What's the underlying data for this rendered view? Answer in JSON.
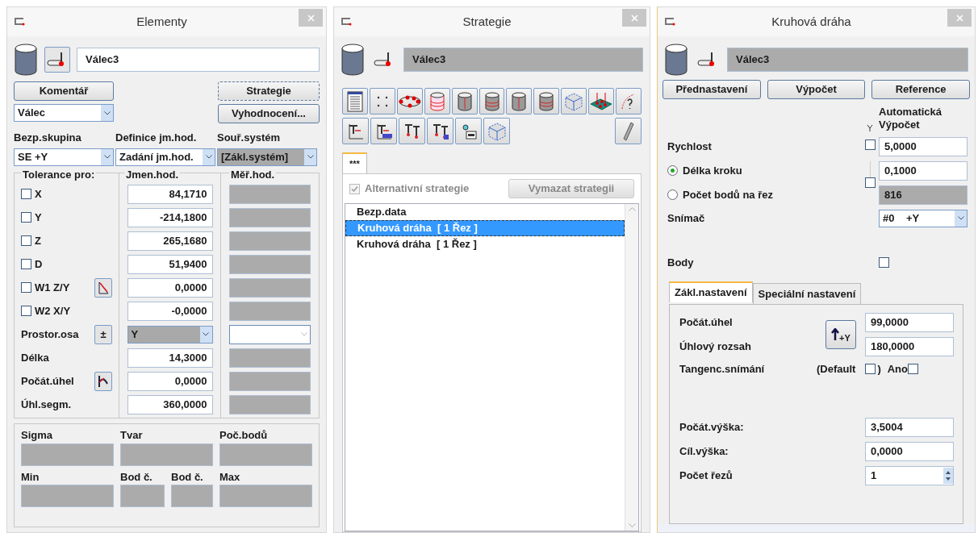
{
  "elementy": {
    "title": "Elementy",
    "name_value": "Válec3",
    "comment_button": "Komentář",
    "strategy_button": "Strategie",
    "eval_button": "Vyhodnocení...",
    "type_select": "Válec",
    "selects": [
      {
        "label": "Bezp.skupina",
        "value": "SE +Y",
        "disabled": false
      },
      {
        "label": "Definice jm.hod.",
        "value": "Zadání jm.hod.",
        "disabled": false
      },
      {
        "label": "Souř.systém",
        "value": "[Zákl.systém]",
        "disabled": true
      }
    ],
    "tolerance": {
      "headers": [
        "Tolerance pro:",
        "Jmen.hod.",
        "Měř.hod."
      ],
      "rows": [
        {
          "kind": "check",
          "label": "X",
          "checked": false,
          "nominal": "84,1710"
        },
        {
          "kind": "check",
          "label": "Y",
          "checked": false,
          "nominal": "-214,1800"
        },
        {
          "kind": "check",
          "label": "Z",
          "checked": false,
          "nominal": "265,1680"
        },
        {
          "kind": "check",
          "label": "D",
          "checked": false,
          "nominal": "51,9400"
        },
        {
          "kind": "check_tool",
          "label": "W1 Z/Y",
          "checked": false,
          "nominal": "0,0000"
        },
        {
          "kind": "check",
          "label": "W2 X/Y",
          "checked": false,
          "nominal": "-0,0000"
        },
        {
          "kind": "axis",
          "label": "Prostor.osa",
          "tool_label": "±",
          "nominal": "Y"
        },
        {
          "kind": "value",
          "label": "Délka",
          "nominal": "14,3000"
        },
        {
          "kind": "value_tool",
          "label": "Počát.úhel",
          "nominal": "0,0000"
        },
        {
          "kind": "value",
          "label": "Úhl.segm.",
          "nominal": "360,0000"
        }
      ]
    },
    "stats": {
      "row_1": [
        "Sigma",
        "Tvar",
        "Poč.bodů"
      ],
      "row_2": [
        "Min",
        "Bod č.",
        "Bod č.",
        "Max"
      ]
    }
  },
  "strategie": {
    "title": "Strategie",
    "name_value": "Válec3",
    "tabs": [
      {
        "label": "***",
        "selected": true
      }
    ],
    "alternative": {
      "label": "Alternativní strategie",
      "checked": true
    },
    "clear_button": "Vymazat strategii",
    "list": [
      {
        "label": "Bezp.data",
        "selected": false
      },
      {
        "label": "Kruhová dráha  [ 1 Řez ]",
        "selected": true
      },
      {
        "label": "Kruhová dráha  [ 1 Řez ]",
        "selected": false
      }
    ]
  },
  "kruhova_draha": {
    "title": "Kruhová dráha",
    "name_value": "Válec3",
    "buttons": [
      "Přednastavení",
      "Výpočet",
      "Reference"
    ],
    "auto_header": [
      "Automatická",
      "Výpočet"
    ],
    "speed": {
      "label": "Rychlost",
      "auto_checked": false,
      "value": "5,0000"
    },
    "modes": [
      {
        "label": "Délka kroku",
        "selected": true,
        "value": "0,1000"
      },
      {
        "label": "Počet bodů na řez",
        "selected": false,
        "value": "816"
      }
    ],
    "mode_auto_checked": false,
    "probe": {
      "label": "Snímač",
      "value": "#0    +Y"
    },
    "points": {
      "label": "Body",
      "checked": false
    },
    "tabs": [
      {
        "label": "Zákl.nastavení",
        "selected": true
      },
      {
        "label": "Speciální nastavení",
        "selected": false
      }
    ],
    "start_angle": {
      "label": "Počát.úhel",
      "value": "99,0000"
    },
    "angle_range": {
      "label": "Úhlový rozsah",
      "value": "180,0000"
    },
    "axis_button": "+Y",
    "tangent": {
      "label": "Tangenc.snímání",
      "default_label": "(Default",
      "default_checked": false,
      "close": ")",
      "yes_label": "Ano",
      "yes_checked": false
    },
    "start_height": {
      "label": "Počát.výška:",
      "value": "3,5004"
    },
    "target_height": {
      "label": "Cíl.výška:",
      "value": "0,0000"
    },
    "cuts": {
      "label": "Počet řezů",
      "value": "1"
    }
  }
}
